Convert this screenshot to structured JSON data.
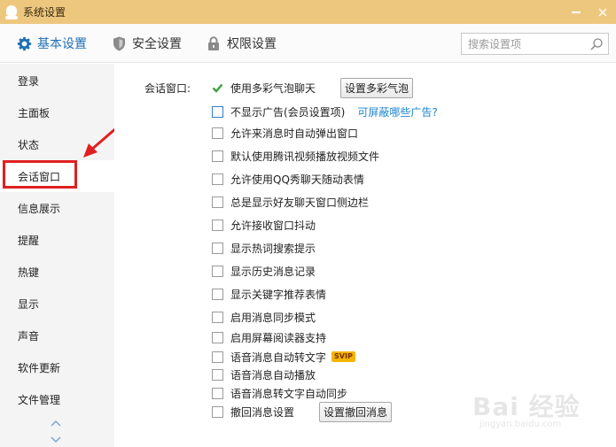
{
  "window": {
    "title": "系统设置"
  },
  "tabs": [
    {
      "label": "基本设置",
      "icon": "gear-icon",
      "active": true
    },
    {
      "label": "安全设置",
      "icon": "shield-icon",
      "active": false
    },
    {
      "label": "权限设置",
      "icon": "lock-icon",
      "active": false
    }
  ],
  "search": {
    "placeholder": "搜索设置项",
    "value": ""
  },
  "sidebar": {
    "items": [
      {
        "label": "登录"
      },
      {
        "label": "主面板"
      },
      {
        "label": "状态"
      },
      {
        "label": "会话窗口",
        "active": true
      },
      {
        "label": "信息展示"
      },
      {
        "label": "提醒"
      },
      {
        "label": "热键"
      },
      {
        "label": "显示"
      },
      {
        "label": "声音"
      },
      {
        "label": "软件更新"
      },
      {
        "label": "文件管理"
      }
    ]
  },
  "main": {
    "section_label": "会话窗口:",
    "options": [
      {
        "label": "使用多彩气泡聊天",
        "checked": true,
        "button": "设置多彩气泡"
      },
      {
        "label": "不显示广告(会员设置项)",
        "checked": false,
        "link": "可屏蔽哪些广告?"
      },
      {
        "label": "允许来消息时自动弹出窗口",
        "checked": false
      },
      {
        "label": "默认使用腾讯视频播放视频文件",
        "checked": false
      },
      {
        "label": "允许使用QQ秀聊天随动表情",
        "checked": false
      },
      {
        "label": "总是显示好友聊天窗口侧边栏",
        "checked": false
      },
      {
        "label": "允许接收窗口抖动",
        "checked": false
      },
      {
        "label": "显示热词搜索提示",
        "checked": false
      },
      {
        "label": "显示历史消息记录",
        "checked": false
      },
      {
        "label": "显示关键字推荐表情",
        "checked": false
      },
      {
        "label": "启用消息同步模式",
        "checked": false
      },
      {
        "label": "启用屏幕阅读器支持",
        "checked": false
      },
      {
        "label": "语音消息自动转文字",
        "checked": false,
        "badge": "SVIP"
      },
      {
        "label": "语音消息自动播放",
        "checked": false
      },
      {
        "label": "语音消息转文字自动同步",
        "checked": false
      },
      {
        "label": "撤回消息设置",
        "checked": false,
        "button": "设置撤回消息"
      }
    ]
  },
  "watermark": {
    "line1": "Bai 经验",
    "line2": "jingyan.baidu.com"
  },
  "colors": {
    "titlebar": "#eec77f",
    "accent": "#1f6fb8",
    "check": "#3aa33a",
    "link": "#1f86d0",
    "highlight": "#e02020"
  }
}
